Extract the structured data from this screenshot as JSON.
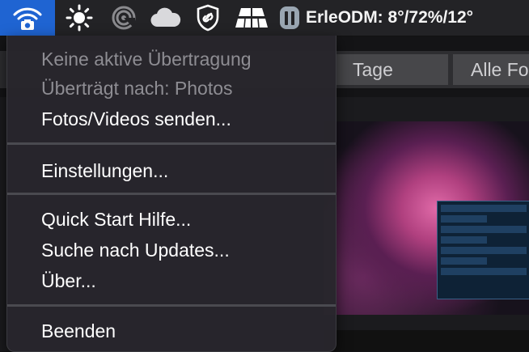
{
  "menubar": {
    "icons": {
      "wifi": "wifi-camera-icon",
      "brightness": "sun-icon",
      "speed": "speed-gauge-icon",
      "cloud": "cloud-icon",
      "shield": "shield-link-icon",
      "solar": "solar-panel-icon",
      "battery": "battery-icon"
    },
    "weather_text": "ErleODM: 8°/72%/12°"
  },
  "background": {
    "tabs": [
      "Tage",
      "Alle Fo"
    ]
  },
  "menu": {
    "status_line_1": "Keine aktive Übertragung",
    "status_line_2": "Überträgt nach: Photos",
    "send": "Fotos/Videos senden...",
    "settings": "Einstellungen...",
    "quick_start": "Quick Start Hilfe...",
    "updates": "Suche nach Updates...",
    "about": "Über...",
    "quit": "Beenden"
  },
  "colors": {
    "active_menubar_item": "#1f64d2",
    "menu_background": "#28262c",
    "disabled_text": "#8e8d93"
  }
}
